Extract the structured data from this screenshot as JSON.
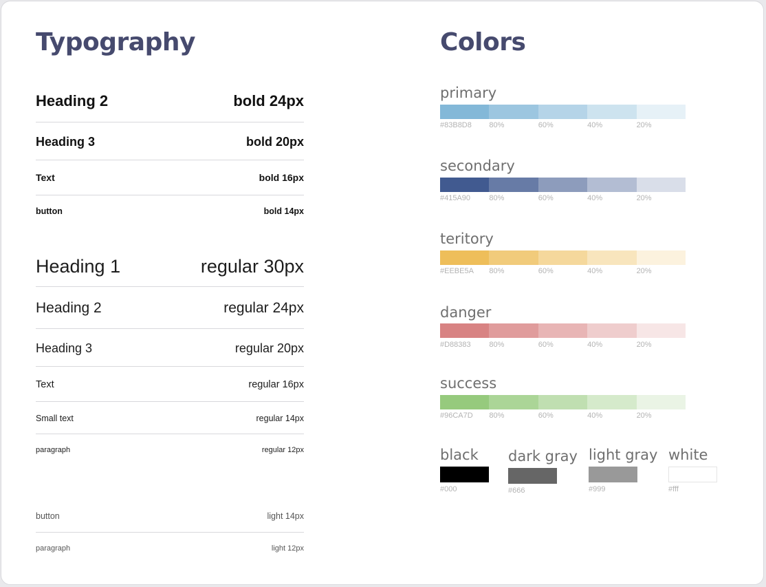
{
  "typography": {
    "title": "Typography",
    "bold": [
      {
        "name": "Heading 2",
        "spec": "bold 24px",
        "size": 22
      },
      {
        "name": "Heading 3",
        "spec": "bold 20px",
        "size": 18
      },
      {
        "name": "Text",
        "spec": "bold 16px",
        "size": 14
      },
      {
        "name": "button",
        "spec": "bold 14px",
        "size": 12.5
      }
    ],
    "regular": [
      {
        "name": "Heading 1",
        "spec": "regular 30px",
        "size": 27
      },
      {
        "name": "Heading 2",
        "spec": "regular 24px",
        "size": 21
      },
      {
        "name": "Heading 3",
        "spec": "regular 20px",
        "size": 18
      },
      {
        "name": "Text",
        "spec": "regular 16px",
        "size": 14.5
      },
      {
        "name": "Small text",
        "spec": "regular 14px",
        "size": 12.5
      },
      {
        "name": "paragraph",
        "spec": "regular 12px",
        "size": 11
      }
    ],
    "light": [
      {
        "name": "button",
        "spec": "light 14px",
        "size": 12.5
      },
      {
        "name": "paragraph",
        "spec": "light 12px",
        "size": 11
      }
    ]
  },
  "colors": {
    "title": "Colors",
    "palettes": [
      {
        "name": "primary",
        "hex": "#83B8D8",
        "base": "#83b8d8",
        "shades": [
          "#83b8d8",
          "#9cc6e0",
          "#b5d4e8",
          "#cde3ef",
          "#e6f1f7"
        ],
        "labels": [
          "#83B8D8",
          "80%",
          "60%",
          "40%",
          "20%"
        ]
      },
      {
        "name": "secondary",
        "hex": "#415A90",
        "base": "#415a90",
        "shades": [
          "#415a90",
          "#677ba6",
          "#8d9cbc",
          "#b3bdd3",
          "#d9dee9"
        ],
        "labels": [
          "#415A90",
          "80%",
          "60%",
          "40%",
          "20%"
        ]
      },
      {
        "name": "teritory",
        "hex": "#EEBE5A",
        "base": "#eebe5a",
        "shades": [
          "#eebe5a",
          "#f1cb7b",
          "#f5d89c",
          "#f8e5bd",
          "#fcf2de"
        ],
        "labels": [
          "#EEBE5A",
          "80%",
          "60%",
          "40%",
          "20%"
        ]
      },
      {
        "name": "danger",
        "hex": "#D88383",
        "base": "#d88383",
        "shades": [
          "#d88383",
          "#e09c9c",
          "#e8b5b5",
          "#efcdcd",
          "#f7e6e6"
        ],
        "labels": [
          "#D88383",
          "80%",
          "60%",
          "40%",
          "20%"
        ]
      },
      {
        "name": "success",
        "hex": "#96CA7D",
        "base": "#96ca7d",
        "shades": [
          "#96ca7d",
          "#abd597",
          "#c0dfb1",
          "#d5eacb",
          "#eaf4e5"
        ],
        "labels": [
          "#96CA7D",
          "80%",
          "60%",
          "40%",
          "20%"
        ]
      }
    ],
    "neutrals": [
      {
        "name": "black",
        "hex": "#000",
        "color": "#000000"
      },
      {
        "name": "dark gray",
        "hex": "#666",
        "color": "#666666"
      },
      {
        "name": "light gray",
        "hex": "#999",
        "color": "#999999"
      },
      {
        "name": "white",
        "hex": "#fff",
        "color": "#ffffff"
      }
    ]
  }
}
